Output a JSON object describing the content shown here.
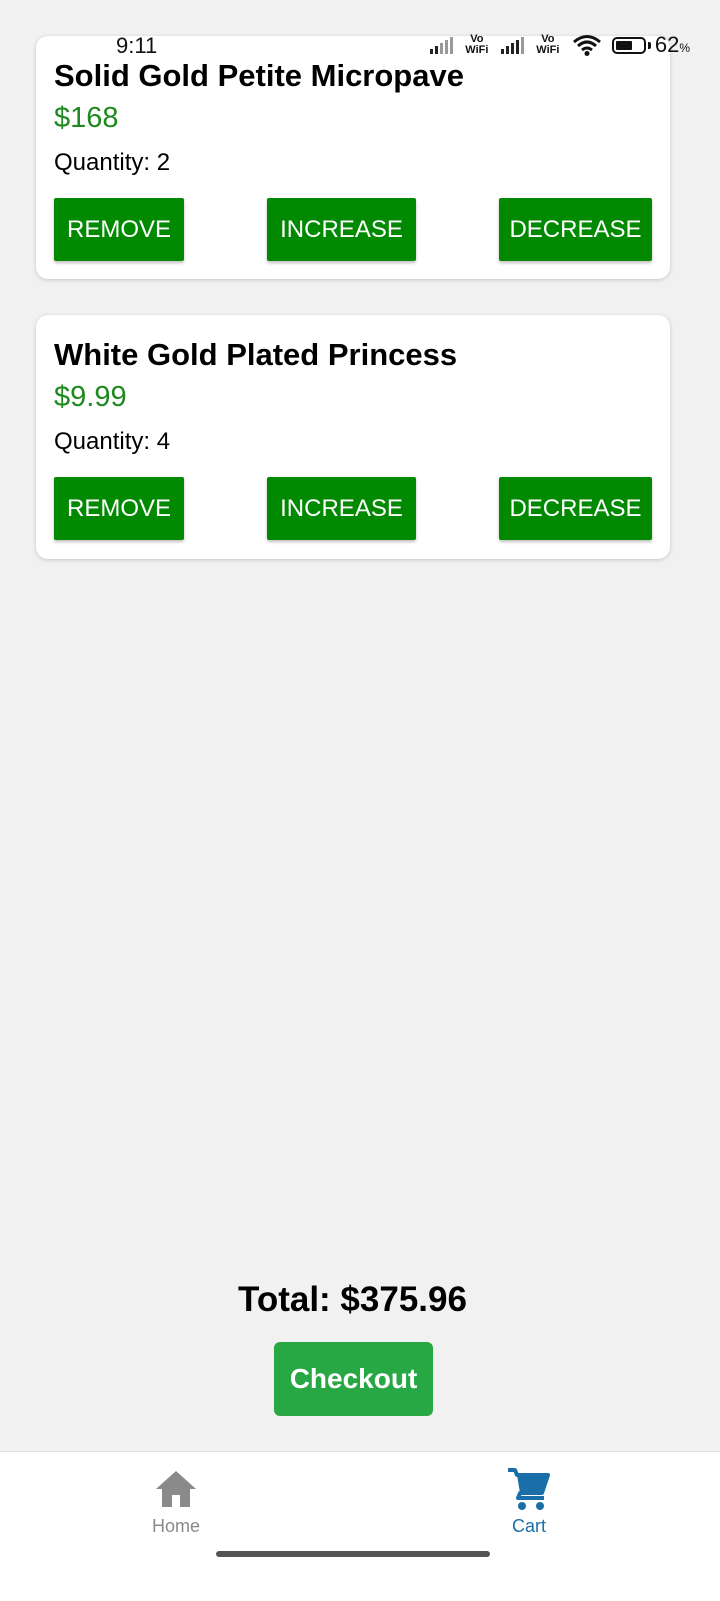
{
  "status_bar": {
    "time": "9:11",
    "wifi_label_1": "Vo WiFi",
    "wifi_label_2": "Vo WiFi",
    "battery_percent": "62",
    "battery_percent_sign": "%",
    "battery_level": 0.62
  },
  "cart": {
    "items": [
      {
        "name": "Solid Gold Petite Micropave",
        "price": "$168",
        "quantity_text": "Quantity: 2",
        "remove_label": "REMOVE",
        "increase_label": "INCREASE",
        "decrease_label": "DECREASE"
      },
      {
        "name": "White Gold Plated Princess",
        "price": "$9.99",
        "quantity_text": "Quantity: 4",
        "remove_label": "REMOVE",
        "increase_label": "INCREASE",
        "decrease_label": "DECREASE"
      }
    ],
    "total_text": "Total: $375.96",
    "checkout_label": "Checkout"
  },
  "bottom_nav": {
    "items": [
      {
        "label": "Home",
        "icon": "home-icon",
        "active": false
      },
      {
        "label": "Cart",
        "icon": "cart-icon",
        "active": true
      }
    ]
  },
  "colors": {
    "price": "#1e8a1e",
    "action_button": "#018a01",
    "checkout_button": "#28a745",
    "active_nav": "#1a6fa8",
    "inactive_nav": "#8a8a8a"
  }
}
